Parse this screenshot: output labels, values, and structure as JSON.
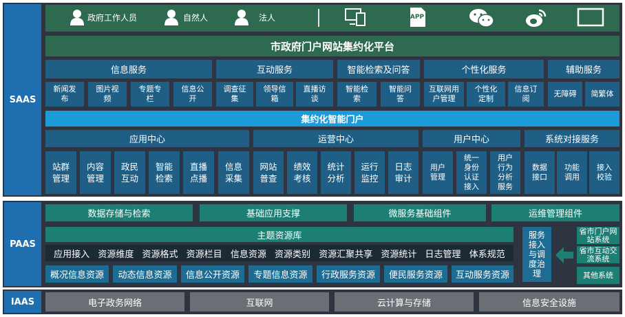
{
  "layers": {
    "saas": "SAAS",
    "paas": "PAAS",
    "iaas": "IAAS"
  },
  "users": [
    "政府工作人员",
    "自然人",
    "法人"
  ],
  "device_icons": [
    "desktop-icon",
    "app-icon",
    "wechat-icon",
    "weibo-icon",
    "tablet-icon"
  ],
  "app_icon_text": "APP",
  "platform_title": "市政府门户网站集约化平台",
  "service_categories": [
    {
      "title": "信息服务",
      "items": [
        "新闻发布",
        "图片视频",
        "专题专栏",
        "信息公开"
      ]
    },
    {
      "title": "互动服务",
      "items": [
        "调查征集",
        "领导信箱",
        "直播访谈"
      ]
    },
    {
      "title": "智能检索及问答",
      "items": [
        "智能检索",
        "智能问答"
      ]
    },
    {
      "title": "个性化服务",
      "items": [
        "互联网用户管理",
        "个性化定制",
        "信息订阅"
      ]
    },
    {
      "title": "辅助服务",
      "items": [
        "无障碍",
        "简繁体"
      ]
    }
  ],
  "portal_bar": "集约化智能门户",
  "centers": [
    {
      "title": "应用中心",
      "items": [
        "站群管理",
        "内容管理",
        "政民互动",
        "智能检索",
        "直播点播",
        "信息采集"
      ]
    },
    {
      "title": "运营中心",
      "items": [
        "网站普查",
        "绩效考核",
        "统计分析",
        "运行监控",
        "日志审计"
      ]
    },
    {
      "title": "用户中心",
      "items": [
        "用户管理",
        "统一身份认证接入",
        "用户行为分析服务"
      ]
    },
    {
      "title": "系统对接服务",
      "items": [
        "数据接口",
        "功能调用",
        "接入校验"
      ]
    }
  ],
  "paas_top": [
    "数据存储与检索",
    "基础应用支撑",
    "微服务基础组件",
    "运维管理组件"
  ],
  "theme_repo": "主题资源库",
  "repo_items": [
    "应用接入",
    "资源维度",
    "资源格式",
    "资源栏目",
    "信息资源",
    "资源类别",
    "资源汇聚共享",
    "资源统计",
    "日志管理",
    "体系规范"
  ],
  "resource_items": [
    "概况信息资源",
    "动态信息资源",
    "信息公开资源",
    "专题信息资源",
    "行政服务资源",
    "便民服务资源",
    "互动服务资源"
  ],
  "governance": "服务接入与调度治理",
  "external_systems": [
    "省市门户网站系统",
    "省市互动交流系统",
    "其他系统"
  ],
  "iaas_items": [
    "电子政务网络",
    "互联网",
    "云计算与存储",
    "信息安全设施"
  ],
  "colors": {
    "layer_bg": "#2e3440",
    "side_label": "#1f6fb0",
    "green": "#2d6a4f",
    "blue": "#1f5f86",
    "gray": "#6b6e74"
  }
}
